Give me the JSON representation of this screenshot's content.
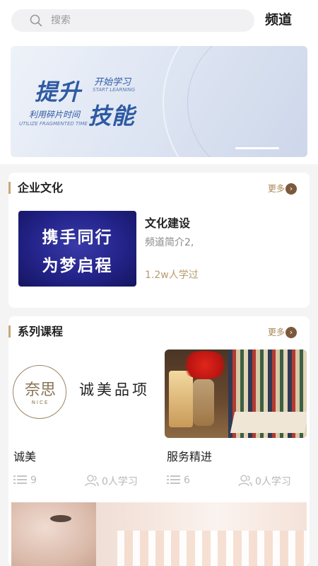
{
  "search": {
    "placeholder": "搜索",
    "icon": "search-icon"
  },
  "header": {
    "channel_label": "频道"
  },
  "banner": {
    "headline_1": "提升",
    "headline_2": "技能",
    "sub_cn_1": "开始学习",
    "sub_en_1": "START LEARNING",
    "sub_cn_2": "利用碎片时间",
    "sub_en_2": "UTILIZE FRAGMENTED TIME"
  },
  "culture": {
    "title": "企业文化",
    "more": "更多",
    "thumb_line_1": "携手同行",
    "thumb_line_2": "为梦启程",
    "course_title": "文化建设",
    "course_desc": "频道简介2,",
    "learners": "1.2w人学过"
  },
  "series": {
    "title": "系列课程",
    "more": "更多",
    "courses": [
      {
        "name": "诚美",
        "lessons": "9",
        "learners": "0人学习",
        "logo_cn": "奈思",
        "logo_en": "NICE",
        "thumb_label": "诚美品项"
      },
      {
        "name": "服务精进",
        "lessons": "6",
        "learners": "0人学习"
      }
    ]
  },
  "colors": {
    "accent": "#c9a77c",
    "more_text": "#a98658",
    "banner_blue": "#2e5aa3",
    "learners_gold": "#b99a6e"
  }
}
